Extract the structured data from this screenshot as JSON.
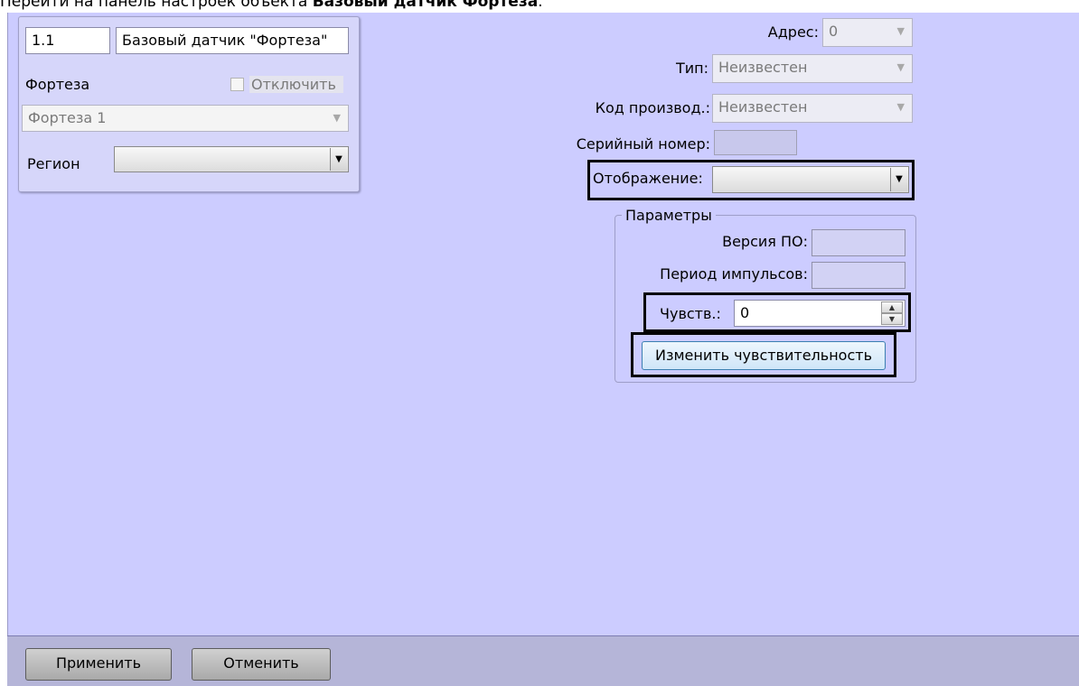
{
  "caption": {
    "prefix": "Перейти на панель настроек объекта ",
    "object": "Базовый датчик Фортеза",
    "suffix": "."
  },
  "left_group": {
    "id_value": "1.1",
    "name_value": "Базовый датчик \"Фортеза\"",
    "parent_label": "Фортеза",
    "disable_label": "Отключить",
    "disable_checked": false,
    "parent_value": "Фортеза 1",
    "region_label": "Регион",
    "region_value": ""
  },
  "right_fields": {
    "address_label": "Адрес:",
    "address_value": "0",
    "type_label": "Тип:",
    "type_value": "Неизвестен",
    "manufacturer_label": "Код производ.:",
    "manufacturer_value": "Неизвестен",
    "serial_label": "Серийный номер:",
    "serial_value": "",
    "display_label": "Отображение:",
    "display_value": ""
  },
  "parameters": {
    "legend": "Параметры",
    "firmware_label": "Версия ПО:",
    "firmware_value": "",
    "pulse_label": "Период импульсов:",
    "pulse_value": "",
    "sensitivity_label": "Чувств.:",
    "sensitivity_value": "0",
    "change_button": "Изменить чувствительность"
  },
  "footer": {
    "apply": "Применить",
    "cancel": "Отменить"
  },
  "colors": {
    "panel": "#ccccff",
    "footer": "#b5b5d8",
    "highlight": "#000000"
  }
}
